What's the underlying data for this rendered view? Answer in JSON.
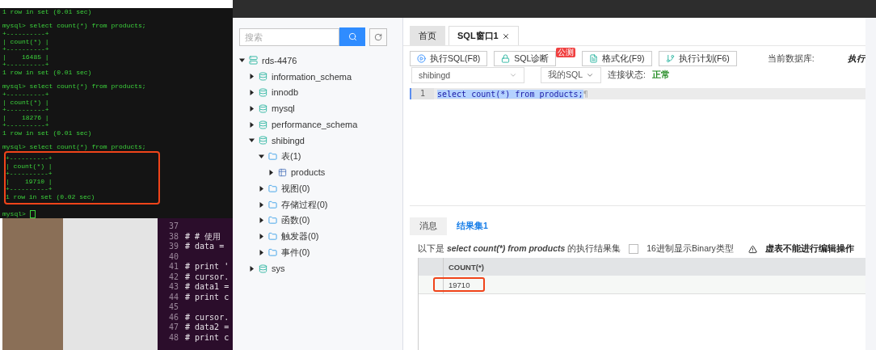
{
  "terminal": {
    "lines": [
      {
        "kind": "text",
        "text": "1 row in set (0.01 sec)",
        "highlighted": false
      },
      {
        "kind": "blank",
        "highlighted": false
      },
      {
        "kind": "text",
        "text": "mysql> select count(*) from products;",
        "highlighted": false
      },
      {
        "kind": "text",
        "text": "+----------+",
        "highlighted": false
      },
      {
        "kind": "text",
        "text": "| count(*) |",
        "highlighted": false
      },
      {
        "kind": "text",
        "text": "+----------+",
        "highlighted": false
      },
      {
        "kind": "text",
        "text": "|    16485 |",
        "highlighted": false
      },
      {
        "kind": "text",
        "text": "+----------+",
        "highlighted": false
      },
      {
        "kind": "text",
        "text": "1 row in set (0.01 sec)",
        "highlighted": false
      },
      {
        "kind": "blank",
        "highlighted": false
      },
      {
        "kind": "text",
        "text": "mysql> select count(*) from products;",
        "highlighted": false
      },
      {
        "kind": "text",
        "text": "+----------+",
        "highlighted": false
      },
      {
        "kind": "text",
        "text": "| count(*) |",
        "highlighted": false
      },
      {
        "kind": "text",
        "text": "+----------+",
        "highlighted": false
      },
      {
        "kind": "text",
        "text": "|    18276 |",
        "highlighted": false
      },
      {
        "kind": "text",
        "text": "+----------+",
        "highlighted": false
      },
      {
        "kind": "text",
        "text": "1 row in set (0.01 sec)",
        "highlighted": false
      },
      {
        "kind": "blank",
        "highlighted": false
      },
      {
        "kind": "text",
        "text": "mysql> select count(*) from products;",
        "highlighted": false
      },
      {
        "kind": "text",
        "text": "+----------+",
        "highlighted": true
      },
      {
        "kind": "text",
        "text": "| count(*) |",
        "highlighted": true
      },
      {
        "kind": "text",
        "text": "+----------+",
        "highlighted": true
      },
      {
        "kind": "text",
        "text": "|    19710 |",
        "highlighted": true
      },
      {
        "kind": "text",
        "text": "+----------+",
        "highlighted": true
      },
      {
        "kind": "text",
        "text": "1 row in set (0.02 sec)",
        "highlighted": true
      },
      {
        "kind": "blank",
        "highlighted": false
      },
      {
        "kind": "prompt",
        "text": "mysql>",
        "highlighted": false
      }
    ]
  },
  "code_editor": {
    "lines": [
      {
        "number": "37"
      },
      {
        "number": "38",
        "code": "# # 使用"
      },
      {
        "number": "39",
        "code": "# data ="
      },
      {
        "number": "40"
      },
      {
        "number": "41",
        "code": "# print '"
      },
      {
        "number": "42",
        "code": "# cursor."
      },
      {
        "number": "43",
        "code": "# data1 ="
      },
      {
        "number": "44",
        "code": "# print c"
      },
      {
        "number": "45"
      },
      {
        "number": "46",
        "code": "# cursor."
      },
      {
        "number": "47",
        "code": "# data2 ="
      },
      {
        "number": "48",
        "code": "# print c"
      }
    ]
  },
  "sidebar": {
    "search": {
      "placeholder": "搜索"
    },
    "tree": [
      {
        "kind": "server",
        "label": "rds-4476",
        "expanded": true,
        "children": [
          {
            "kind": "database",
            "label": "information_schema",
            "expanded": false
          },
          {
            "kind": "database",
            "label": "innodb",
            "expanded": false
          },
          {
            "kind": "database",
            "label": "mysql",
            "expanded": false
          },
          {
            "kind": "database",
            "label": "performance_schema",
            "expanded": false
          },
          {
            "kind": "database",
            "label": "shibingd",
            "expanded": true,
            "children": [
              {
                "kind": "folder",
                "label": "表(1)",
                "expanded": true,
                "children": [
                  {
                    "kind": "table",
                    "label": "products",
                    "expanded": false
                  }
                ]
              },
              {
                "kind": "folder",
                "label": "视图(0)",
                "expanded": false
              },
              {
                "kind": "folder",
                "label": "存储过程(0)",
                "expanded": false
              },
              {
                "kind": "folder",
                "label": "函数(0)",
                "expanded": false
              },
              {
                "kind": "folder",
                "label": "触发器(0)",
                "expanded": false
              },
              {
                "kind": "folder",
                "label": "事件(0)",
                "expanded": false
              }
            ]
          },
          {
            "kind": "database",
            "label": "sys",
            "expanded": false
          }
        ]
      }
    ]
  },
  "tabs": [
    {
      "label": "首页",
      "selected": false,
      "closable": false
    },
    {
      "label": "SQL窗口1",
      "selected": true,
      "closable": true
    }
  ],
  "toolbar": {
    "buttons": [
      {
        "kind": "run",
        "label": "执行SQL(F8)"
      },
      {
        "kind": "diagnose",
        "label": "SQL诊断",
        "badge": "公测"
      },
      {
        "kind": "format",
        "label": "格式化(F9)"
      },
      {
        "kind": "plan",
        "label": "执行计划(F6)"
      }
    ],
    "current_db_label": "当前数据库:",
    "right_label": "执行",
    "database_select": "shibingd",
    "sql_select": "我的SQL",
    "status_label": "连接状态:",
    "status_value": "正常"
  },
  "editor": {
    "lines": [
      {
        "number": "1",
        "code": "select count(*) from products;",
        "end_mark": "¶",
        "selected": true
      }
    ]
  },
  "result_tabs": [
    {
      "label": "消息",
      "selected": false
    },
    {
      "label": "结果集1",
      "selected": true
    }
  ],
  "result_info": {
    "prefix": "以下是",
    "query": "select count(*) from products",
    "suffix": "的执行结果集",
    "hex_checkbox": {
      "label": "16进制显示Binary类型",
      "checked": false
    },
    "warning": "虚表不能进行编辑操作"
  },
  "result_table": {
    "columns": [
      "COUNT(*)"
    ],
    "rows": [
      {
        "cells": [
          "19710"
        ],
        "highlighted": true
      }
    ]
  }
}
